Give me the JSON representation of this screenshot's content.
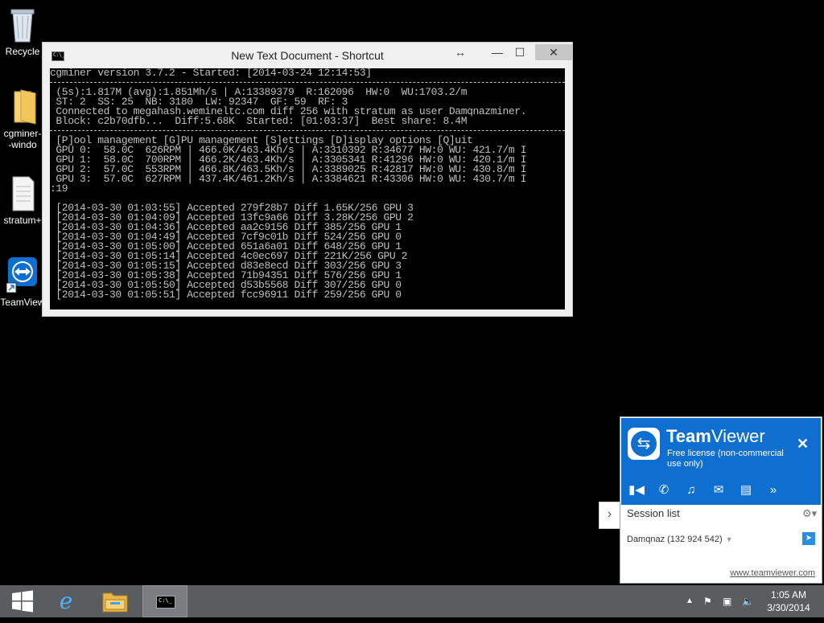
{
  "desktop": {
    "icons": [
      {
        "label": "Recycle"
      },
      {
        "label": "cgminer-"
      },
      {
        "label": "-windo"
      },
      {
        "label": "stratum+"
      },
      {
        "label": "TeamView"
      }
    ]
  },
  "console_window": {
    "title": "New Text Document - Shortcut",
    "header_line": "cgminer version 3.7.2 - Started: [2014-03-24 12:14:53]",
    "stats_lines": [
      " (5s):1.817M (avg):1.851Mh/s | A:13389379  R:162096  HW:0  WU:1703.2/m",
      " ST: 2  SS: 25  NB: 3180  LW: 92347  GF: 59  RF: 3",
      " Connected to megahash.wemineltc.com diff 256 with stratum as user Damqnazminer.",
      " Block: c2b70dfb...  Diff:5.68K  Started: [01:03:37]  Best share: 8.4M"
    ],
    "menu_line": " [P]ool management [G]PU management [S]ettings [D]isplay options [Q]uit",
    "gpu_lines": [
      " GPU 0:  58.0C  626RPM | 466.0K/463.4Kh/s | A:3310392 R:34677 HW:0 WU: 421.7/m I",
      " GPU 1:  58.0C  700RPM | 466.2K/463.4Kh/s | A:3305341 R:41296 HW:0 WU: 420.1/m I",
      " GPU 2:  57.0C  553RPM | 466.8K/463.5Kh/s | A:3389025 R:42817 HW:0 WU: 430.8/m I",
      " GPU 3:  57.0C  627RPM | 437.4K/461.2Kh/s | A:3384621 R:43306 HW:0 WU: 430.7/m I"
    ],
    "wrap_line": ":19",
    "log_lines": [
      " [2014-03-30 01:03:55] Accepted 279f28b7 Diff 1.65K/256 GPU 3",
      " [2014-03-30 01:04:09] Accepted 13fc9a66 Diff 3.28K/256 GPU 2",
      " [2014-03-30 01:04:36] Accepted aa2c9156 Diff 385/256 GPU 1",
      " [2014-03-30 01:04:49] Accepted 7cf9c01b Diff 524/256 GPU 0",
      " [2014-03-30 01:05:00] Accepted 651a6a01 Diff 648/256 GPU 1",
      " [2014-03-30 01:05:14] Accepted 4c0ec697 Diff 221K/256 GPU 2",
      " [2014-03-30 01:05:15] Accepted d83e8ecd Diff 303/256 GPU 3",
      " [2014-03-30 01:05:38] Accepted 71b94351 Diff 576/256 GPU 1",
      " [2014-03-30 01:05:50] Accepted d53b5568 Diff 307/256 GPU 0",
      " [2014-03-30 01:05:51] Accepted fcc96911 Diff 259/256 GPU 0"
    ]
  },
  "teamviewer": {
    "brand_bold": "Team",
    "brand_rest": "Viewer",
    "license": "Free license (non-commercial use only)",
    "session_list": "Session list",
    "partner": "Damqnaz (132 924 542)",
    "link": "www.teamviewer.com"
  },
  "taskbar": {
    "time": "1:05 AM",
    "date": "3/30/2014"
  },
  "colors": {
    "teamviewer_blue": "#0e6fd0",
    "taskbar": "#5a5d60",
    "console_text": "#c0c0c0"
  }
}
